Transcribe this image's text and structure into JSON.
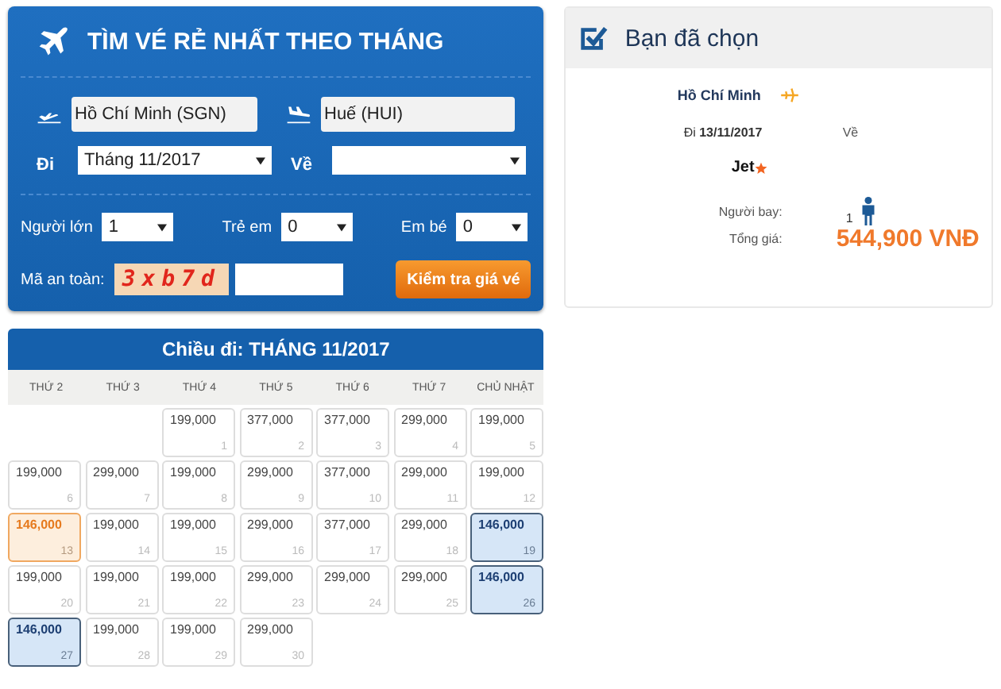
{
  "search_panel": {
    "title": "TÌM VÉ RẺ NHẤT THEO THÁNG",
    "from": {
      "value": "Hồ Chí Minh (SGN)"
    },
    "to": {
      "value": "Huế (HUI)"
    },
    "depart": {
      "label": "Đi",
      "value": "Tháng 11/2017"
    },
    "return": {
      "label": "Về"
    },
    "passengers": [
      {
        "label": "Người lớn",
        "value": "1"
      },
      {
        "label": "Trẻ em",
        "value": "0"
      },
      {
        "label": "Em bé",
        "value": "0"
      }
    ],
    "captcha": {
      "label": "Mã an toàn:",
      "code": "3xb7d"
    },
    "button": "Kiểm tra giá vé"
  },
  "summary": {
    "title": "Bạn đã chọn",
    "city": "Hồ Chí Minh",
    "depart": "Đi **13/11/2017**",
    "return": "Về",
    "airline": "Jet",
    "passengers_label": "Người bay:",
    "passengers": "1",
    "total_label": "Tổng giá:",
    "total": "544,900 VNĐ"
  },
  "calendar": {
    "title": "Chiều đi: THÁNG 11/2017",
    "weekdays": [
      "THỨ 2",
      "THỨ 3",
      "THỨ 4",
      "THỨ 5",
      "THỨ 6",
      "THỨ 7",
      "CHỦ NHẬT"
    ],
    "days": [
      {
        "kind": "blank"
      },
      {
        "kind": "blank"
      },
      {
        "kind": "day",
        "price": "199,000",
        "day": "1",
        "selected": false,
        "cheapest": false
      },
      {
        "kind": "day",
        "price": "377,000",
        "day": "2",
        "selected": false,
        "cheapest": false
      },
      {
        "kind": "day",
        "price": "377,000",
        "day": "3",
        "selected": false,
        "cheapest": false
      },
      {
        "kind": "day",
        "price": "299,000",
        "day": "4",
        "selected": false,
        "cheapest": false
      },
      {
        "kind": "day",
        "price": "199,000",
        "day": "5",
        "selected": false,
        "cheapest": false
      },
      {
        "kind": "day",
        "price": "199,000",
        "day": "6",
        "selected": false,
        "cheapest": false
      },
      {
        "kind": "day",
        "price": "299,000",
        "day": "7",
        "selected": false,
        "cheapest": false
      },
      {
        "kind": "day",
        "price": "199,000",
        "day": "8",
        "selected": false,
        "cheapest": false
      },
      {
        "kind": "day",
        "price": "299,000",
        "day": "9",
        "selected": false,
        "cheapest": false
      },
      {
        "kind": "day",
        "price": "377,000",
        "day": "10",
        "selected": false,
        "cheapest": false
      },
      {
        "kind": "day",
        "price": "299,000",
        "day": "11",
        "selected": false,
        "cheapest": false
      },
      {
        "kind": "day",
        "price": "199,000",
        "day": "12",
        "selected": false,
        "cheapest": false
      },
      {
        "kind": "day",
        "price": "146,000",
        "day": "13",
        "selected": true,
        "cheapest": true
      },
      {
        "kind": "day",
        "price": "199,000",
        "day": "14",
        "selected": false,
        "cheapest": false
      },
      {
        "kind": "day",
        "price": "199,000",
        "day": "15",
        "selected": false,
        "cheapest": false
      },
      {
        "kind": "day",
        "price": "299,000",
        "day": "16",
        "selected": false,
        "cheapest": false
      },
      {
        "kind": "day",
        "price": "377,000",
        "day": "17",
        "selected": false,
        "cheapest": false
      },
      {
        "kind": "day",
        "price": "299,000",
        "day": "18",
        "selected": false,
        "cheapest": false
      },
      {
        "kind": "day",
        "price": "146,000",
        "day": "19",
        "selected": false,
        "cheapest": true
      },
      {
        "kind": "day",
        "price": "199,000",
        "day": "20",
        "selected": false,
        "cheapest": false
      },
      {
        "kind": "day",
        "price": "199,000",
        "day": "21",
        "selected": false,
        "cheapest": false
      },
      {
        "kind": "day",
        "price": "199,000",
        "day": "22",
        "selected": false,
        "cheapest": false
      },
      {
        "kind": "day",
        "price": "299,000",
        "day": "23",
        "selected": false,
        "cheapest": false
      },
      {
        "kind": "day",
        "price": "299,000",
        "day": "24",
        "selected": false,
        "cheapest": false
      },
      {
        "kind": "day",
        "price": "299,000",
        "day": "25",
        "selected": false,
        "cheapest": false
      },
      {
        "kind": "day",
        "price": "146,000",
        "day": "26",
        "selected": false,
        "cheapest": true
      },
      {
        "kind": "day",
        "price": "146,000",
        "day": "27",
        "selected": false,
        "cheapest": true
      },
      {
        "kind": "day",
        "price": "199,000",
        "day": "28",
        "selected": false,
        "cheapest": false
      },
      {
        "kind": "day",
        "price": "199,000",
        "day": "29",
        "selected": false,
        "cheapest": false
      },
      {
        "kind": "day",
        "price": "299,000",
        "day": "30",
        "selected": false,
        "cheapest": false
      }
    ]
  }
}
